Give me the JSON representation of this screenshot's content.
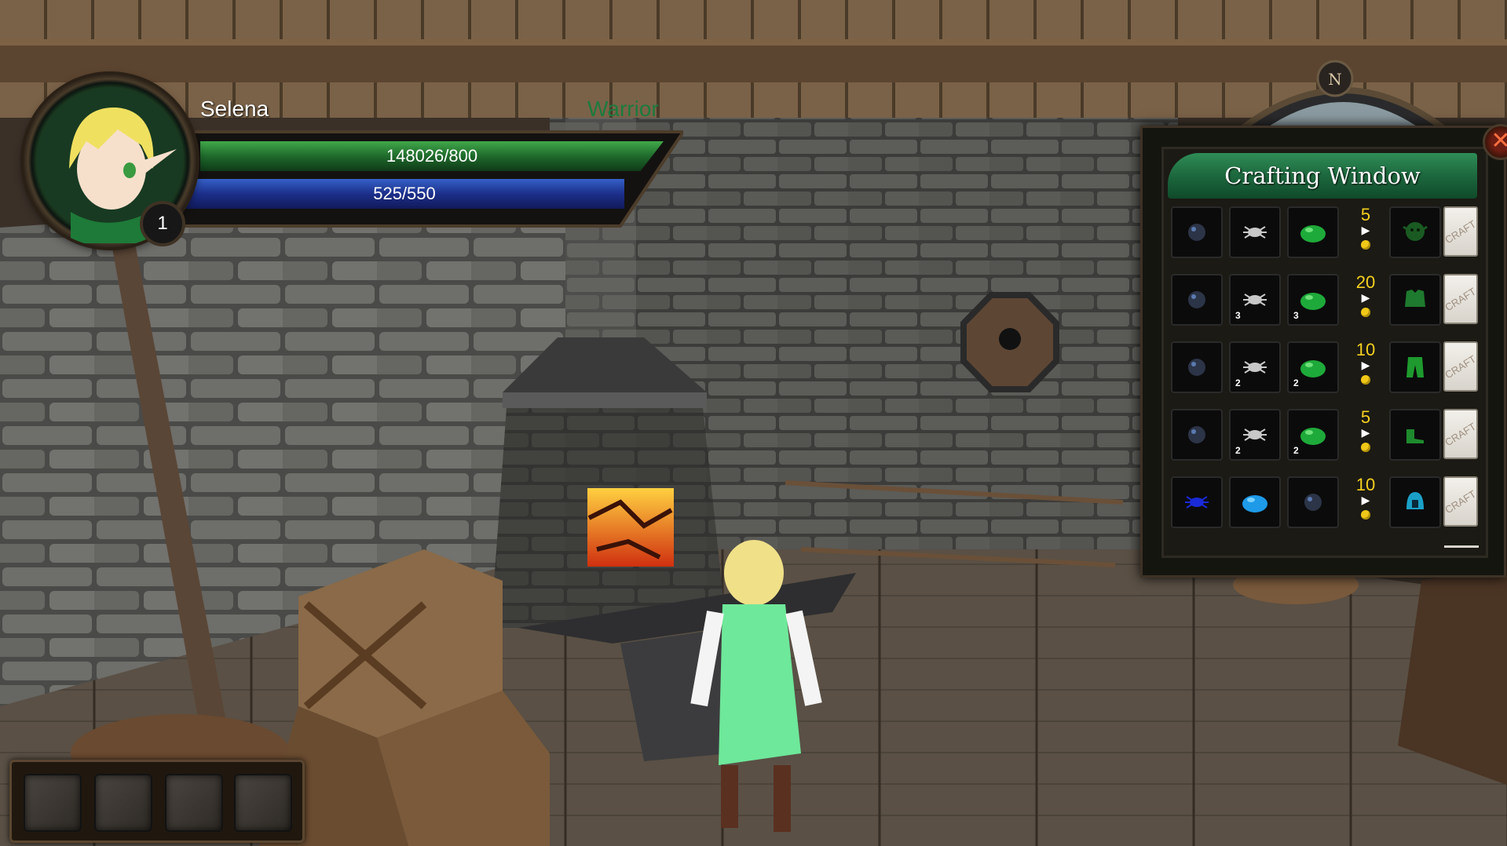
{
  "player": {
    "name": "Selena",
    "class": "Warrior",
    "level": "1",
    "hp_text": "148026/800",
    "mp_text": "525/550",
    "hp_fill": 1.0,
    "mp_fill": 0.95
  },
  "compass": {
    "north_label": "N"
  },
  "hotbar": {
    "slots": 4
  },
  "crafting": {
    "title": "Crafting Window",
    "close_icon": "close-icon",
    "craft_label": "CRAFT",
    "recipes": [
      {
        "inputs": [
          {
            "icon": "iron-orb-icon",
            "qty": ""
          },
          {
            "icon": "spider-icon",
            "qty": ""
          },
          {
            "icon": "green-slime-icon",
            "qty": ""
          }
        ],
        "cost": "5",
        "output_icon": "goblin-head-icon"
      },
      {
        "inputs": [
          {
            "icon": "iron-orb-icon",
            "qty": ""
          },
          {
            "icon": "spider-icon",
            "qty": "3"
          },
          {
            "icon": "green-slime-icon",
            "qty": "3"
          }
        ],
        "cost": "20",
        "output_icon": "green-armor-icon"
      },
      {
        "inputs": [
          {
            "icon": "iron-orb-icon",
            "qty": ""
          },
          {
            "icon": "spider-icon",
            "qty": "2"
          },
          {
            "icon": "green-slime-icon",
            "qty": "2"
          }
        ],
        "cost": "10",
        "output_icon": "green-leggings-icon"
      },
      {
        "inputs": [
          {
            "icon": "iron-orb-icon",
            "qty": ""
          },
          {
            "icon": "spider-icon",
            "qty": "2"
          },
          {
            "icon": "green-slime-icon",
            "qty": "2"
          }
        ],
        "cost": "5",
        "output_icon": "green-boots-icon"
      },
      {
        "inputs": [
          {
            "icon": "blue-spider-icon",
            "qty": ""
          },
          {
            "icon": "blue-slime-icon",
            "qty": ""
          },
          {
            "icon": "iron-orb-icon",
            "qty": ""
          }
        ],
        "cost": "10",
        "output_icon": "blue-helmet-icon"
      }
    ]
  },
  "colors": {
    "hp_bar": "#1f6a2c",
    "mp_bar": "#1c2f8a",
    "class_text": "#1d7a3e",
    "crafting_header": "#1e6b40",
    "cost_text": "#f5d020"
  }
}
